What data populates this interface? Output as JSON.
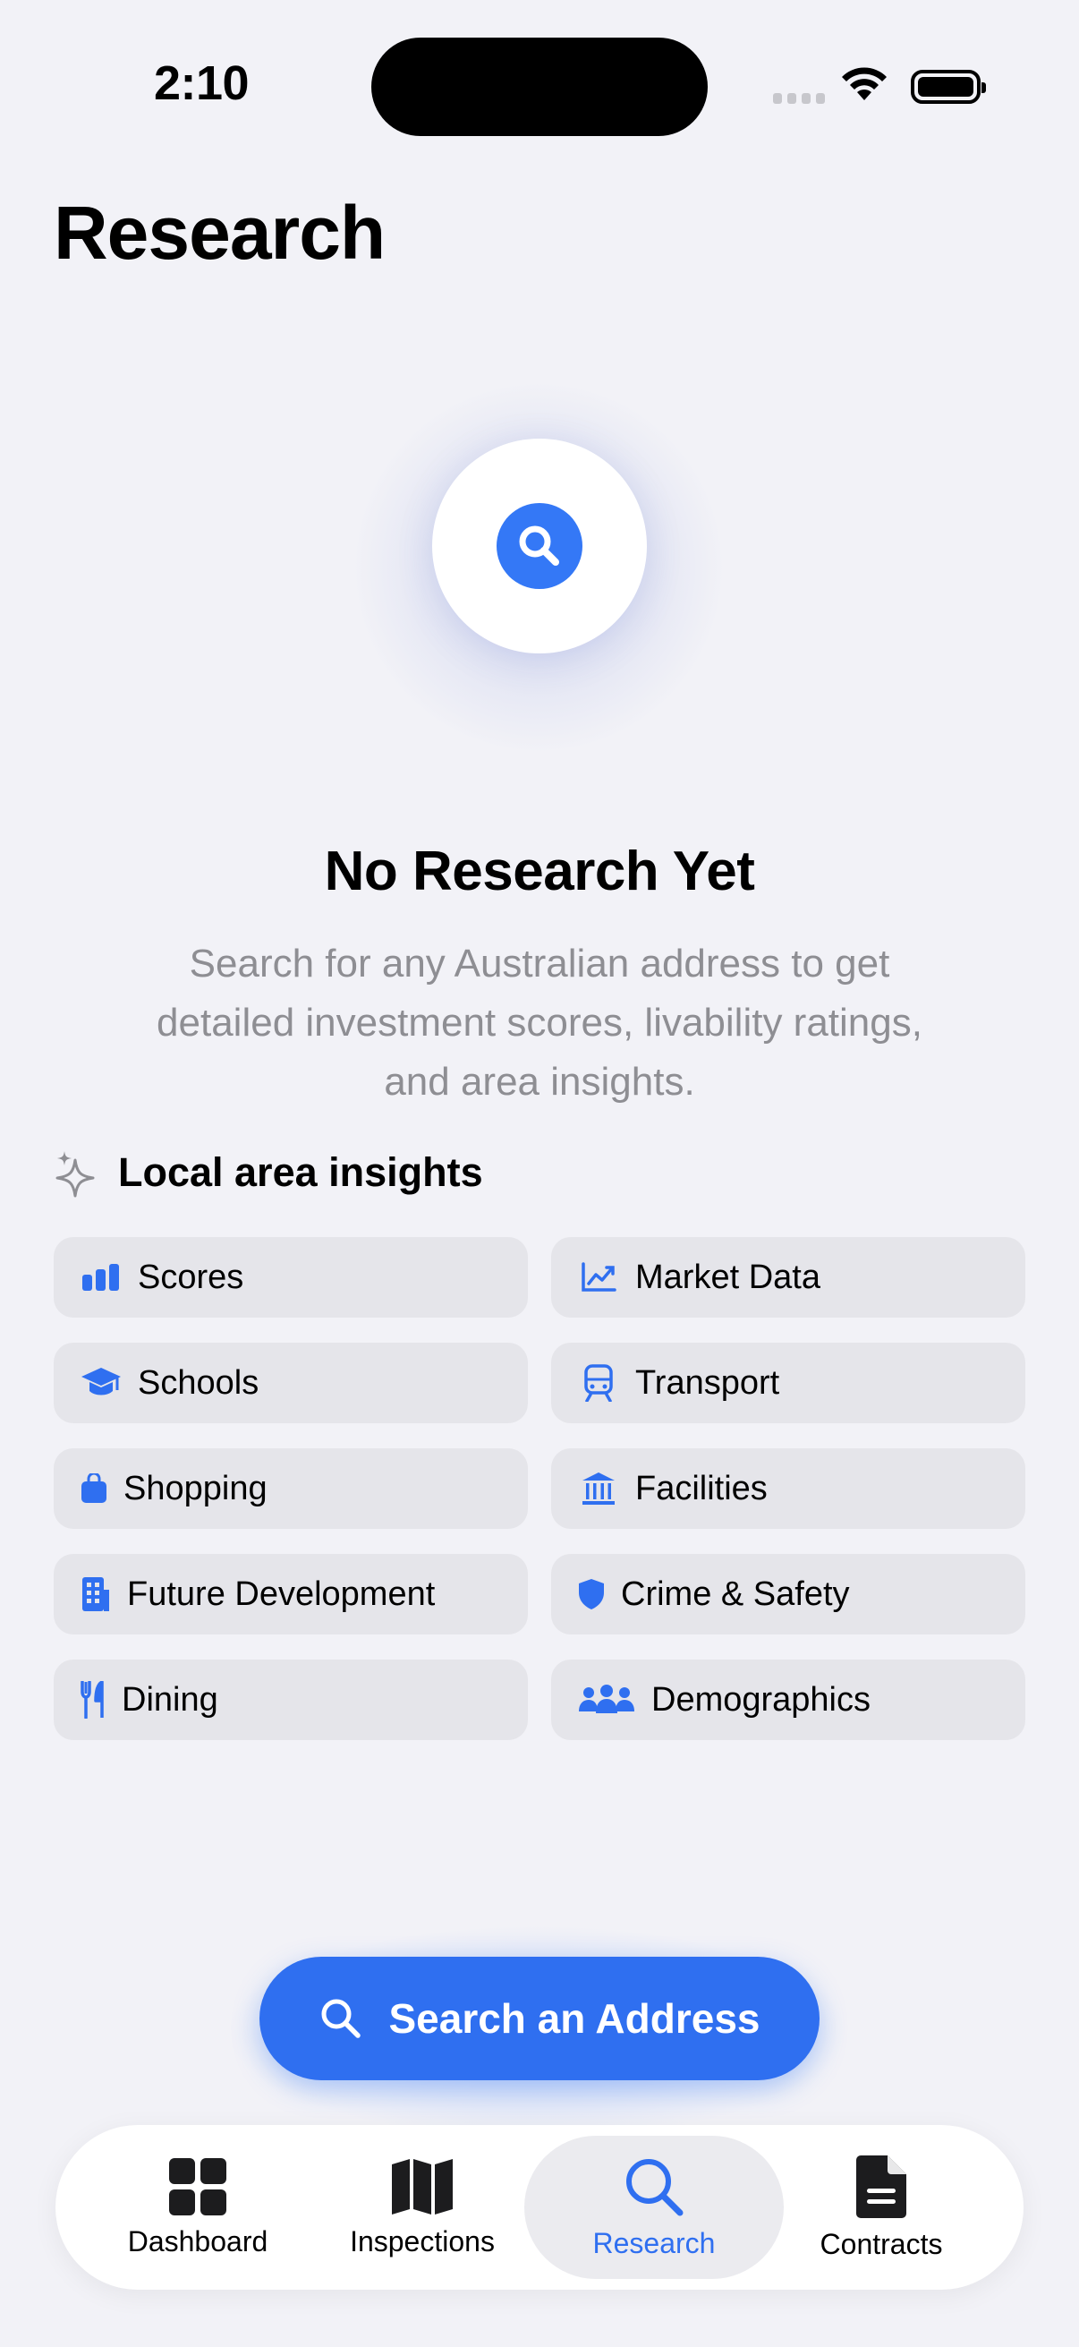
{
  "status": {
    "time": "2:10"
  },
  "header": {
    "title": "Research"
  },
  "empty_state": {
    "title": "No Research Yet",
    "subtitle": "Search for any Australian address to get detailed investment scores, livability ratings, and area insights."
  },
  "insights": {
    "title": "Local area insights",
    "items": [
      {
        "label": "Scores",
        "icon": "bar-chart-icon"
      },
      {
        "label": "Market Data",
        "icon": "trend-chart-icon"
      },
      {
        "label": "Schools",
        "icon": "graduation-cap-icon"
      },
      {
        "label": "Transport",
        "icon": "train-icon"
      },
      {
        "label": "Shopping",
        "icon": "shopping-bag-icon"
      },
      {
        "label": "Facilities",
        "icon": "building-columns-icon"
      },
      {
        "label": "Future Development",
        "icon": "office-building-icon"
      },
      {
        "label": "Crime & Safety",
        "icon": "shield-icon"
      },
      {
        "label": "Dining",
        "icon": "fork-knife-icon"
      },
      {
        "label": "Demographics",
        "icon": "people-icon"
      }
    ]
  },
  "cta": {
    "label": "Search an Address"
  },
  "tabbar": {
    "tabs": [
      {
        "label": "Dashboard",
        "icon": "grid-icon"
      },
      {
        "label": "Inspections",
        "icon": "map-icon"
      },
      {
        "label": "Research",
        "icon": "search-icon"
      },
      {
        "label": "Contracts",
        "icon": "document-icon"
      }
    ],
    "active": "Research"
  },
  "colors": {
    "accent": "#2f6ff0",
    "background": "#f2f2f7",
    "chip": "#e5e5ea",
    "muted": "#8e8e93"
  }
}
